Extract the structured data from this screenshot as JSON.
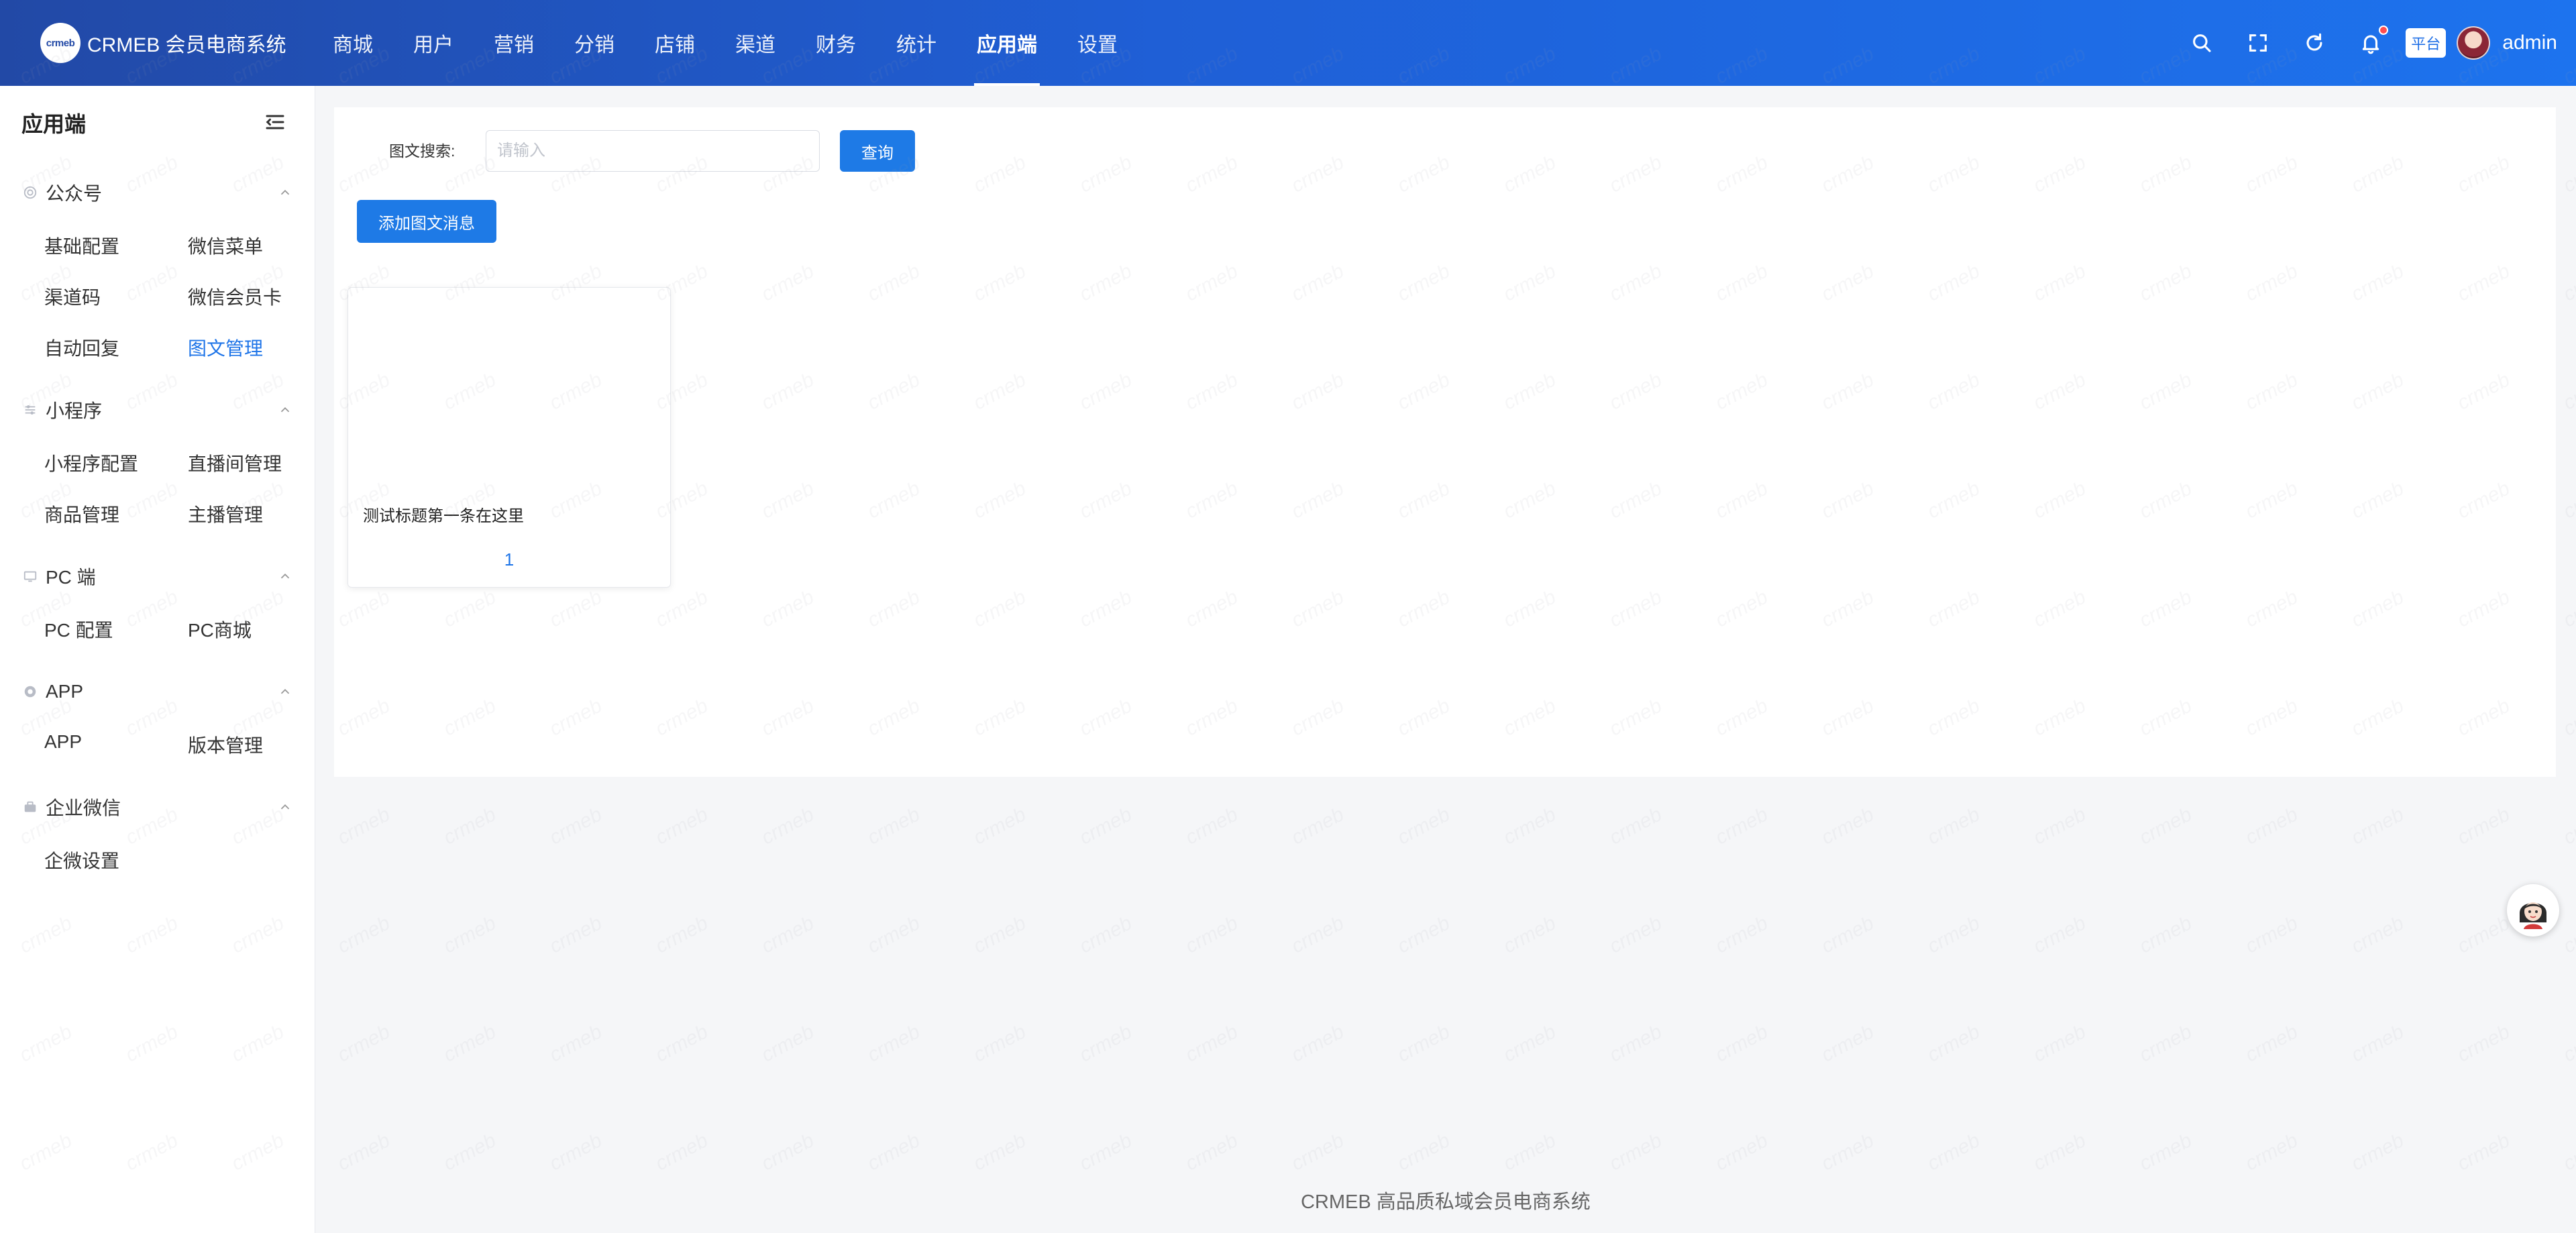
{
  "app": {
    "logo_mark": "crmeb",
    "title": "CRMEB 会员电商系统"
  },
  "topnav": {
    "items": [
      {
        "label": "商城"
      },
      {
        "label": "用户"
      },
      {
        "label": "营销"
      },
      {
        "label": "分销"
      },
      {
        "label": "店铺"
      },
      {
        "label": "渠道"
      },
      {
        "label": "财务"
      },
      {
        "label": "统计"
      },
      {
        "label": "应用端",
        "active": true
      },
      {
        "label": "设置"
      }
    ],
    "active_index": 8
  },
  "header_right": {
    "icons": [
      "search-icon",
      "fullscreen-icon",
      "refresh-icon",
      "bell-icon"
    ],
    "has_notification": true,
    "platform_tag": "平台",
    "username": "admin"
  },
  "sidebar": {
    "title": "应用端",
    "groups": [
      {
        "label": "公众号",
        "icon": "wechat-icon",
        "items": [
          "基础配置",
          "微信菜单",
          "渠道码",
          "微信会员卡",
          "自动回复",
          "图文管理"
        ]
      },
      {
        "label": "小程序",
        "icon": "miniprogram-icon",
        "items": [
          "小程序配置",
          "直播间管理",
          "商品管理",
          "主播管理"
        ]
      },
      {
        "label": "PC 端",
        "icon": "monitor-icon",
        "items": [
          "PC 配置",
          "PC商城"
        ]
      },
      {
        "label": "APP",
        "icon": "app-icon",
        "items": [
          "APP",
          "版本管理"
        ]
      },
      {
        "label": "企业微信",
        "icon": "enterprise-wechat-icon",
        "items": [
          "企微设置"
        ]
      }
    ],
    "active_item": "图文管理"
  },
  "content": {
    "search": {
      "label": "图文搜索:",
      "placeholder": "请输入",
      "value": ""
    },
    "query_button": "查询",
    "add_button": "添加图文消息",
    "cards": [
      {
        "title": "测试标题第一条在这里",
        "index": "1"
      }
    ]
  },
  "footer": {
    "text": "CRMEB 高品质私域会员电商系统"
  },
  "watermark_text": "crmeb",
  "colors": {
    "header_start": "#2249a6",
    "header_end": "#1d73ee",
    "primary": "#1e7ae6",
    "active_text": "#1f75e8",
    "page_bg": "#f5f6f8"
  }
}
